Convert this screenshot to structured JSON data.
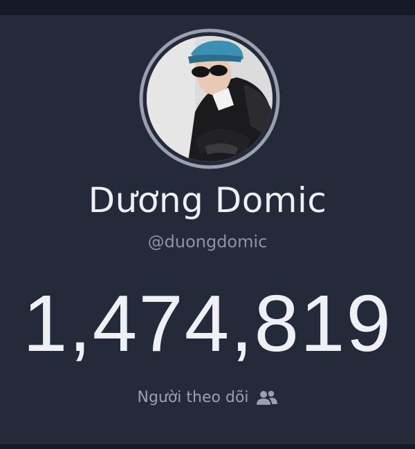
{
  "profile": {
    "display_name": "Dương Domic",
    "handle": "@duongdomic",
    "avatar_icon": "profile-photo",
    "ring_color": "#9aa0ae"
  },
  "stats": {
    "follower_count": "1,474,819",
    "follower_label": "Người theo dõi",
    "label_icon": "users-icon"
  },
  "colors": {
    "background": "#242a3a",
    "primary_text": "#eef0f4",
    "secondary_text": "#8d93a3"
  }
}
